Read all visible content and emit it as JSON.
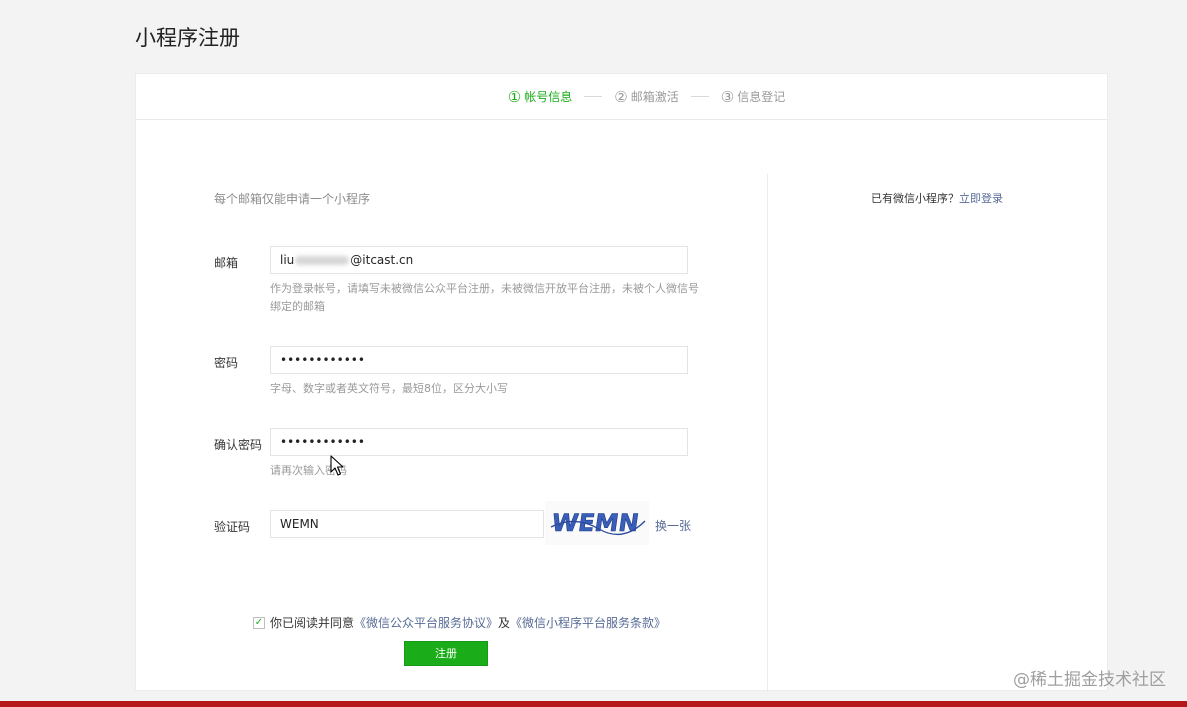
{
  "page_title": "小程序注册",
  "steps": [
    {
      "num": "①",
      "label": "帐号信息"
    },
    {
      "num": "②",
      "label": "邮箱激活"
    },
    {
      "num": "③",
      "label": "信息登记"
    }
  ],
  "hint": "每个邮箱仅能申请一个小程序",
  "email": {
    "label": "邮箱",
    "value_start": "liu",
    "value_end": "@itcast.cn",
    "desc": "作为登录帐号，请填写未被微信公众平台注册，未被微信开放平台注册，未被个人微信号绑定的邮箱"
  },
  "password": {
    "label": "密码",
    "value": "••••••••••••",
    "desc": "字母、数字或者英文符号，最短8位，区分大小写"
  },
  "confirm": {
    "label": "确认密码",
    "value": "••••••••••••",
    "desc": "请再次输入密码"
  },
  "captcha": {
    "label": "验证码",
    "value": "WEMN",
    "image_text": "WEMN",
    "refresh": "换一张"
  },
  "agreement": {
    "prefix": "你已阅读并同意",
    "link1": "《微信公众平台服务协议》",
    "middle": "及",
    "link2": "《微信小程序平台服务条款》"
  },
  "register_button": "注册",
  "login": {
    "prompt": "已有微信小程序？",
    "link": "立即登录"
  },
  "watermark": "@稀土掘金技术社区",
  "colors": {
    "accent": "#1aad19",
    "link": "#576b95",
    "bottom_bar": "#b51818"
  }
}
